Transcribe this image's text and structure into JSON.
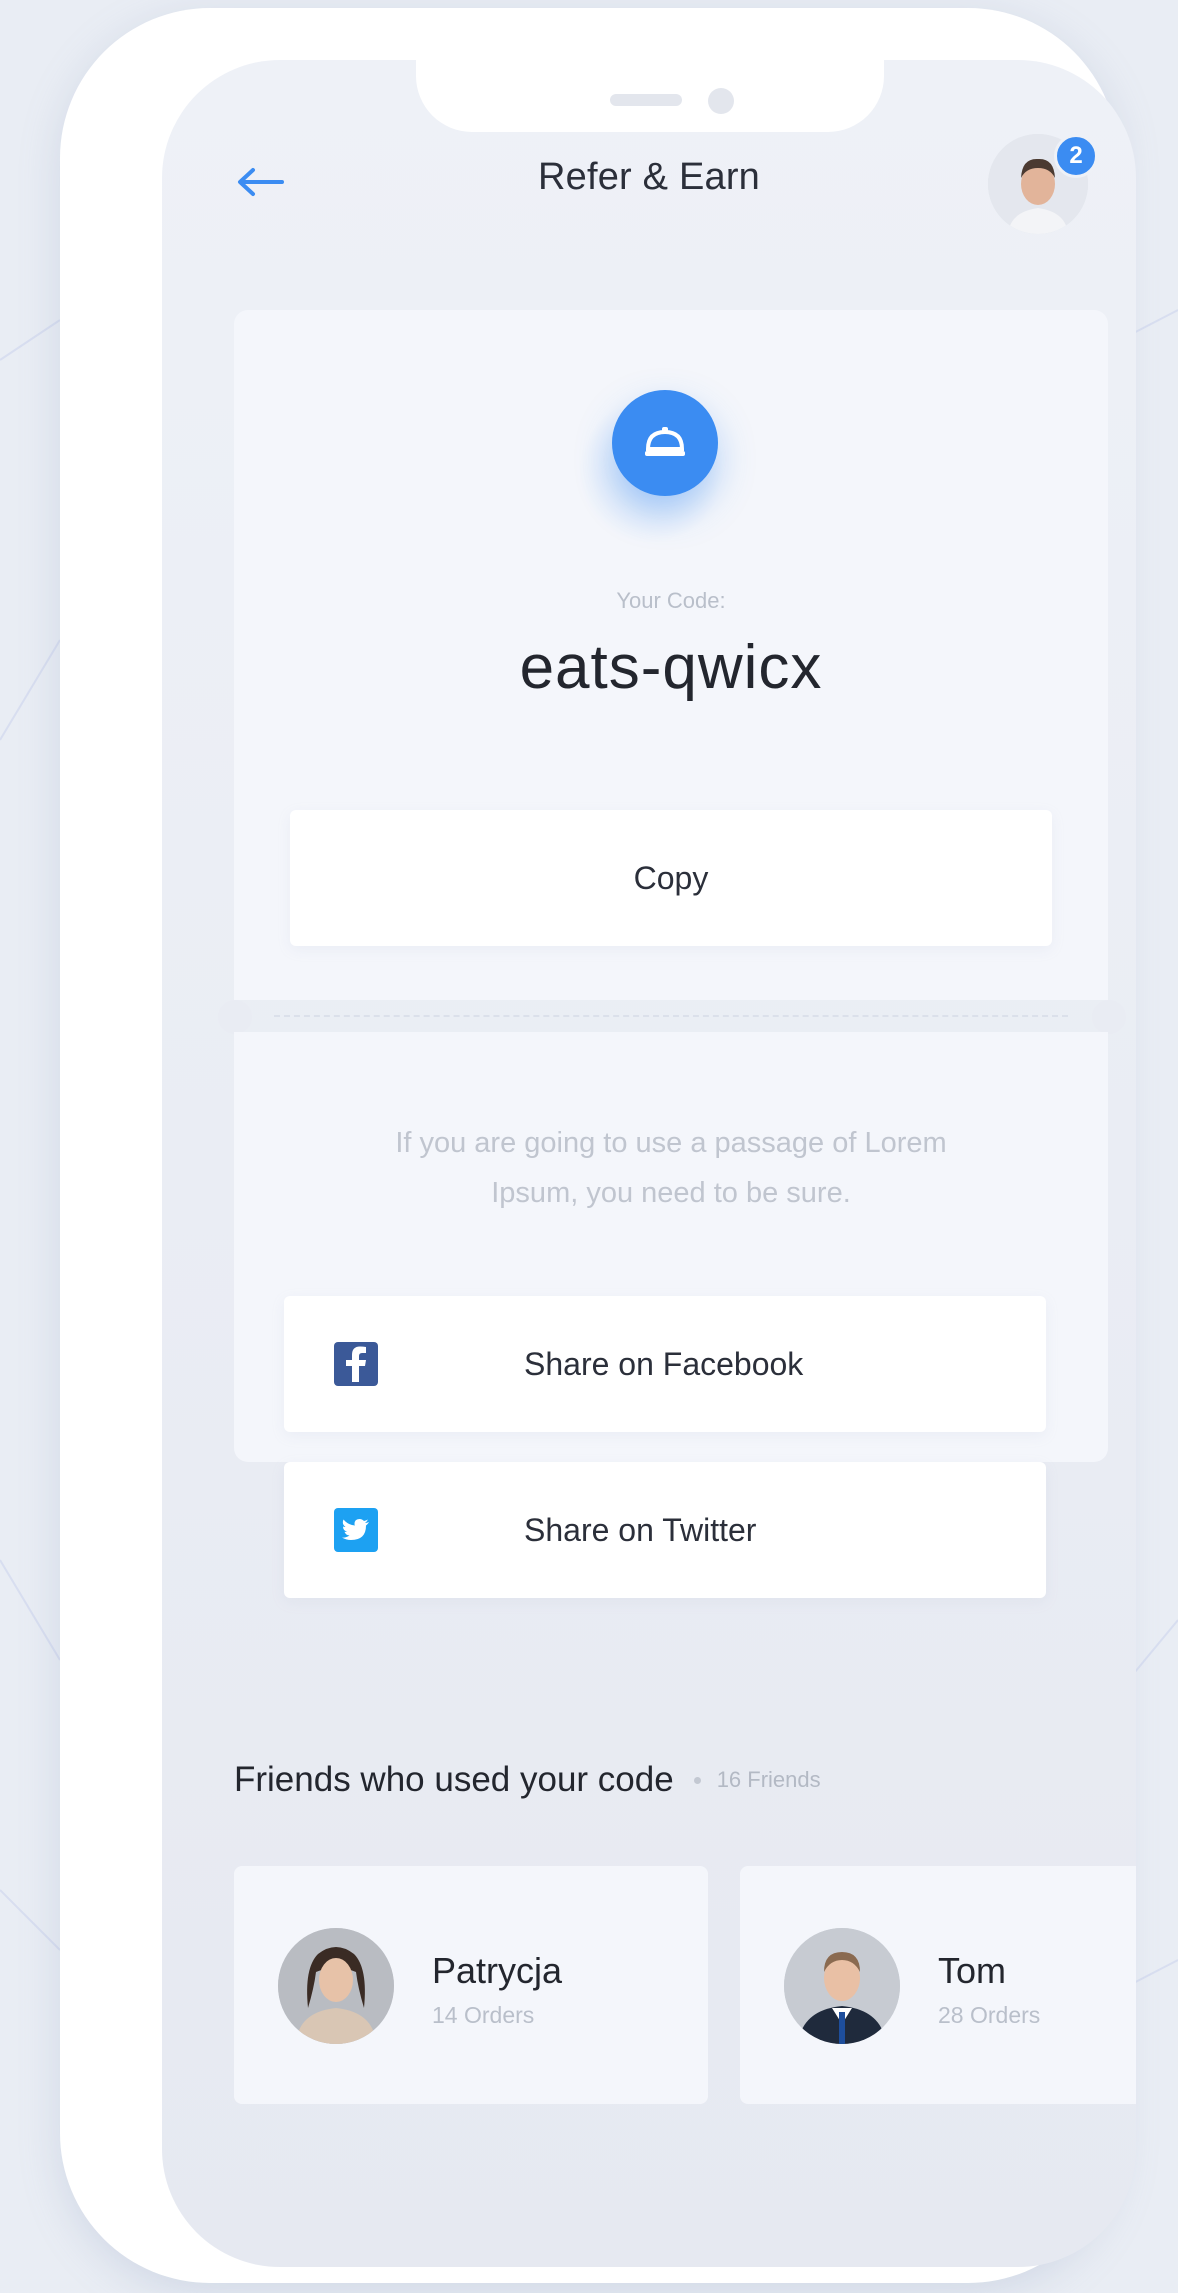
{
  "header": {
    "title": "Refer & Earn",
    "notification_count": "2"
  },
  "code_card": {
    "label": "Your Code:",
    "code": "eats-qwicx",
    "copy_label": "Copy",
    "description_line1": "If you are going to use a passage of Lorem",
    "description_line2": "Ipsum, you need to be sure."
  },
  "share": {
    "facebook_label": "Share on Facebook",
    "twitter_label": "Share on Twitter"
  },
  "friends": {
    "title": "Friends who used your code",
    "count": "16 Friends",
    "items": [
      {
        "name": "Patrycja",
        "orders": "14 Orders"
      },
      {
        "name": "Tom",
        "orders": "28 Orders"
      }
    ]
  },
  "colors": {
    "accent": "#3b8cf2",
    "facebook": "#3b5998",
    "twitter": "#1da1f2",
    "background": "#e9edf4"
  },
  "icons": [
    "back-arrow-icon",
    "food-cloche-icon",
    "facebook-icon",
    "twitter-icon"
  ]
}
